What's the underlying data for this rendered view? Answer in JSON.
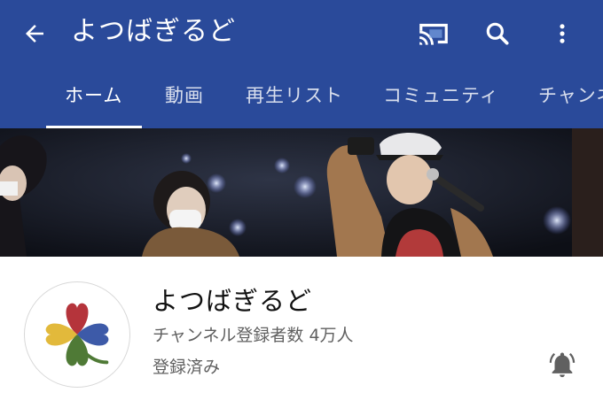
{
  "appbar": {
    "title": "よつばぎるど",
    "icons": {
      "back": "arrow-back-icon",
      "cast": "cast-icon",
      "search": "search-icon",
      "more": "more-vert-icon"
    }
  },
  "tabs": [
    {
      "label": "ホーム",
      "active": true
    },
    {
      "label": "動画"
    },
    {
      "label": "再生リスト"
    },
    {
      "label": "コミュニティ"
    },
    {
      "label": "チャンネル"
    }
  ],
  "channel": {
    "name": "よつばぎるど",
    "subscribers": "チャンネル登録者数 4万人",
    "subscribed": "登録済み",
    "bell_icon": "notification-bell-icon"
  },
  "colors": {
    "appbar": "#2a4a9a",
    "clover": [
      "#b5343b",
      "#3d5aa8",
      "#e2b93b",
      "#4f7a36"
    ]
  }
}
